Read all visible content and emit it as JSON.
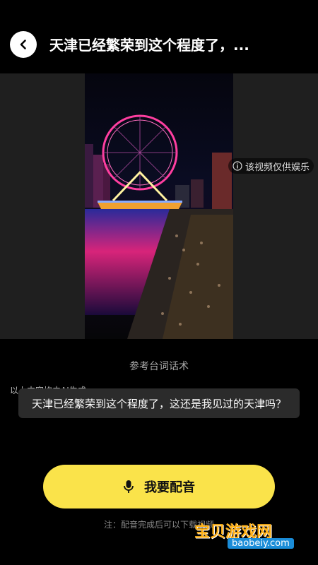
{
  "header": {
    "title": "天津已经繁荣到这个程度了，..."
  },
  "video": {
    "entertainment_notice": "该视频仅供娱乐",
    "ai_notice": "以上内容均由AI生成"
  },
  "script": {
    "label": "参考台词话术",
    "text": "天津已经繁荣到这个程度了，这还是我见过的天津吗？"
  },
  "actions": {
    "dub_button_label": "我要配音"
  },
  "footnote": "注：配音完成后可以下载视频",
  "watermark": {
    "text": "宝贝游戏网",
    "url": "baobeiy.com"
  },
  "colors": {
    "accent": "#fae34a",
    "background": "#000000",
    "panel": "#2b2b2b"
  }
}
